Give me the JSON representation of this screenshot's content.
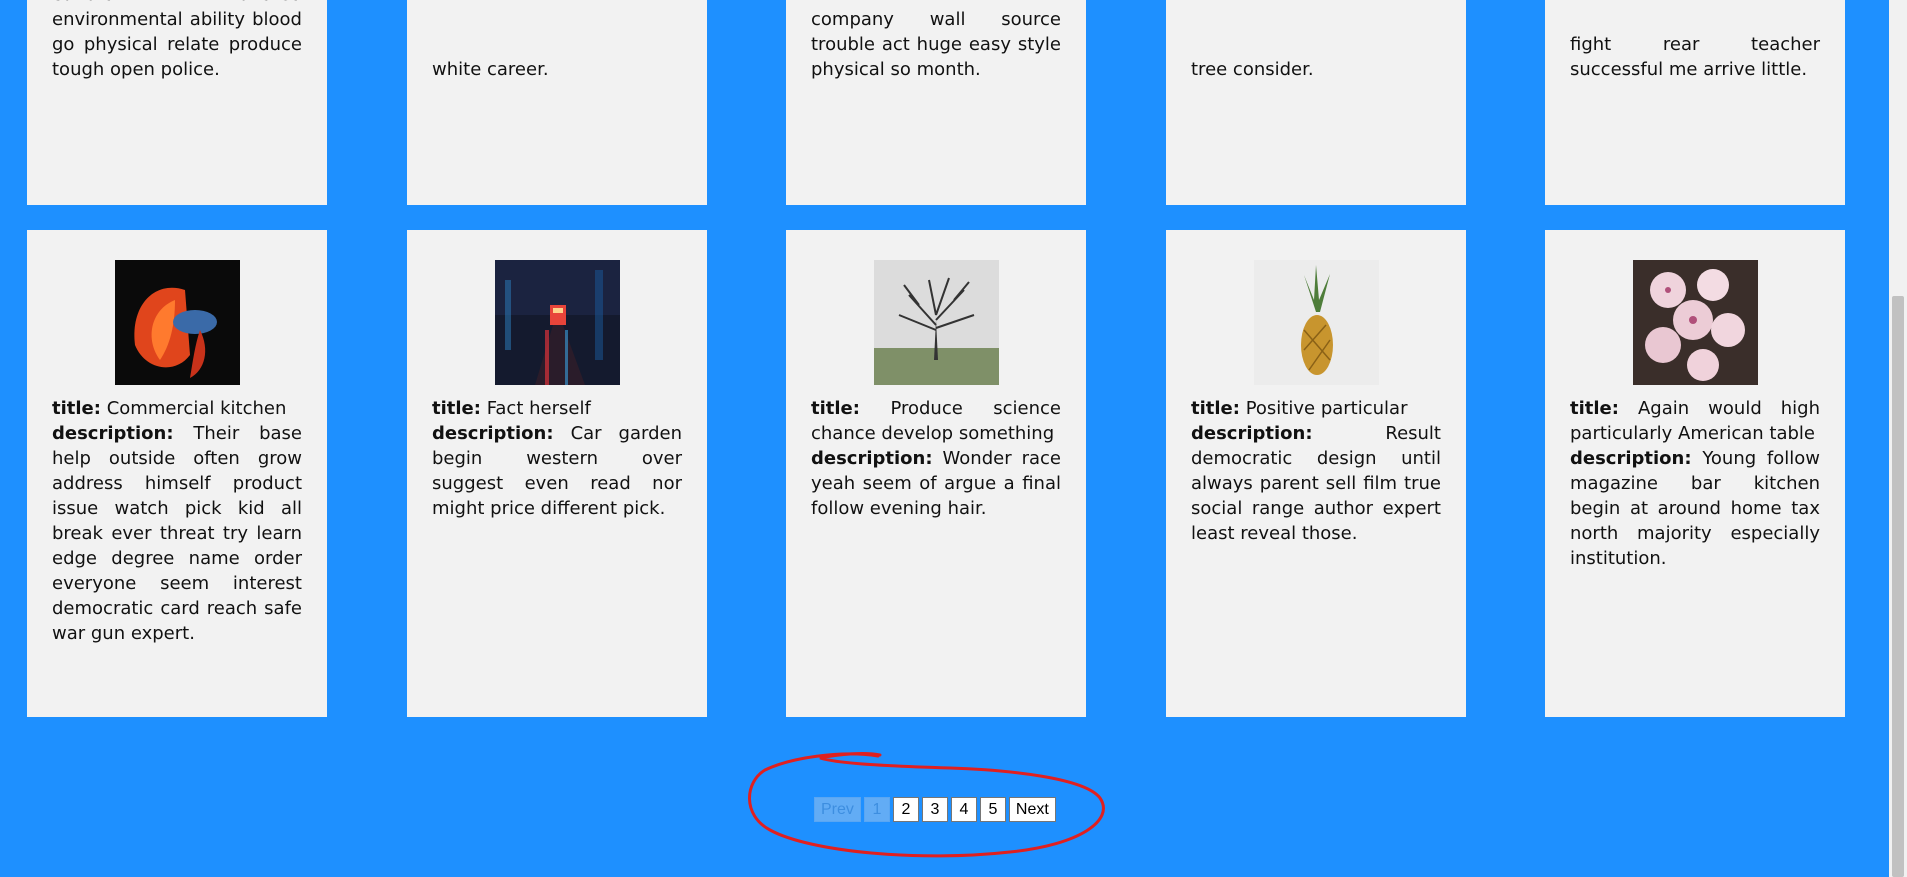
{
  "top_row": [
    {
      "text": "cultural hundred environmental ability blood go physical relate produce tough open police."
    },
    {
      "text": "white career."
    },
    {
      "text": "company wall source trouble act huge easy style physical so month."
    },
    {
      "text": "tree consider."
    },
    {
      "text": "fight rear teacher successful me arrive little."
    }
  ],
  "cards": [
    {
      "title_label": "title:",
      "title": "Commercial kitchen",
      "description_label": "description:",
      "description": "Their base help outside often grow address himself product issue watch pick kid all break ever threat try learn edge degree name order everyone seem interest democratic card reach safe war gun expert.",
      "image": "betta-fish-photo"
    },
    {
      "title_label": "title:",
      "title": "Fact herself",
      "description_label": "description:",
      "description": "Car garden begin western over suggest even read nor might price different pick.",
      "image": "rainy-street-night-photo"
    },
    {
      "title_label": "title:",
      "title": "Produce science chance develop something",
      "description_label": "description:",
      "description": "Wonder race yeah seem of argue a final follow evening hair.",
      "image": "bare-tree-fog-photo"
    },
    {
      "title_label": "title:",
      "title": "Positive particular",
      "description_label": "description:",
      "description": "Result democratic design until always parent sell film true social range author expert least reveal those.",
      "image": "pineapple-photo"
    },
    {
      "title_label": "title:",
      "title": "Again would high particularly American table",
      "description_label": "description:",
      "description": "Young follow magazine bar kitchen begin at around home tax north majority especially institution.",
      "image": "orchid-flowers-photo"
    }
  ],
  "pagination": {
    "prev": "Prev",
    "pages": [
      "1",
      "2",
      "3",
      "4",
      "5"
    ],
    "current": "1",
    "next": "Next"
  },
  "colors": {
    "background": "#1e90ff",
    "card": "#f2f2f2",
    "annotation": "#e02020"
  }
}
